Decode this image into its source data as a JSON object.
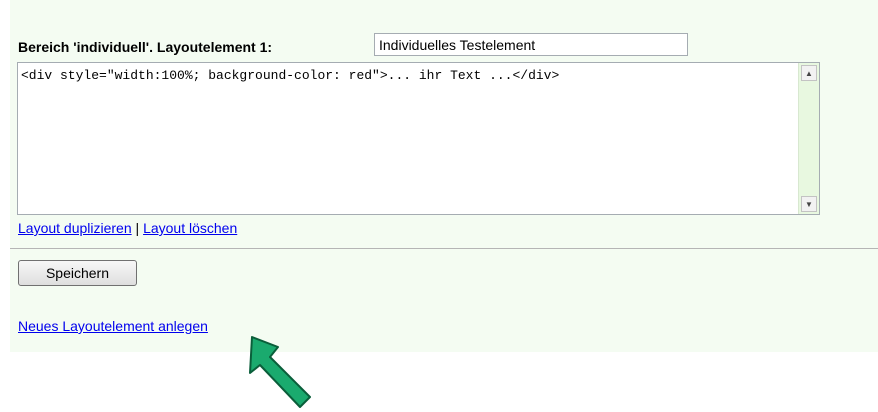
{
  "form": {
    "title": "Bereich 'individuell'. Layoutelement 1:",
    "name_value": "Individuelles Testelement",
    "code_value": "<div style=\"width:100%; background-color: red\">... ihr Text ...</div>",
    "duplicate_link": "Layout duplizieren",
    "separator": "|",
    "delete_link": "Layout löschen",
    "save_button": "Speichern",
    "new_element_link": "Neues Layoutelement anlegen"
  },
  "icons": {
    "scroll_up": "triangle-up",
    "scroll_down": "triangle-down",
    "callout": "green-arrow"
  },
  "colors": {
    "panel_bg": "#f4fcf2",
    "link": "#0000ee",
    "arrow_fill": "#1aaa6e",
    "arrow_stroke": "#0a5e3a"
  }
}
